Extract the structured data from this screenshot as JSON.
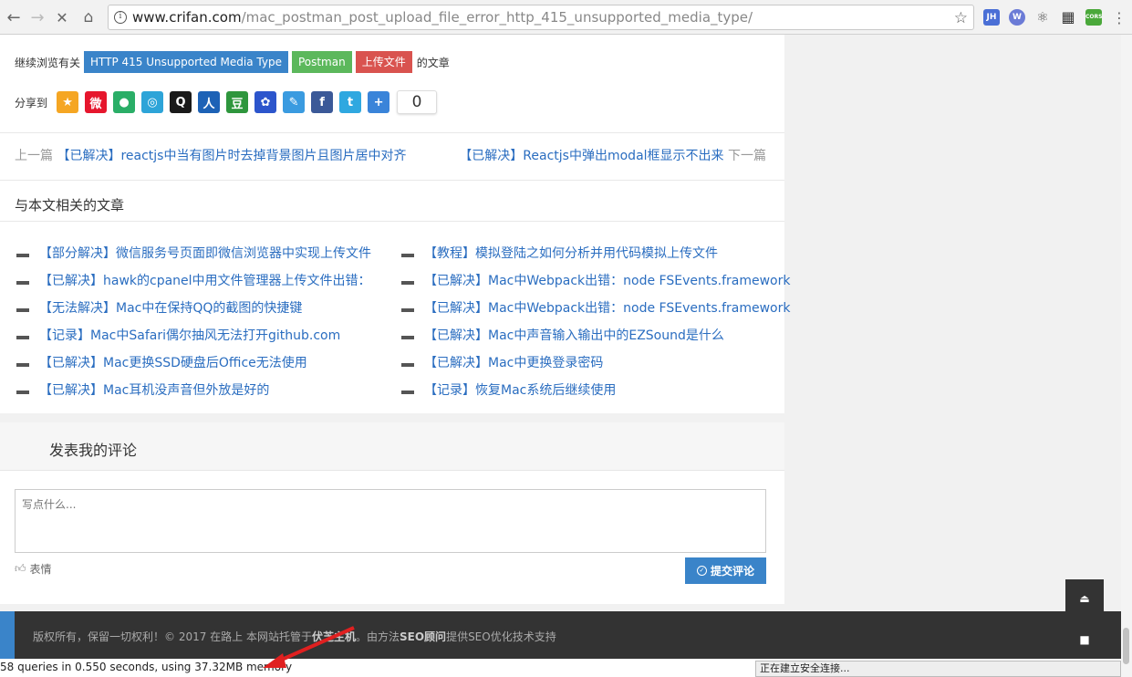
{
  "browser": {
    "url_host": "www.crifan.com",
    "url_path": "/mac_postman_post_upload_file_error_http_415_unsupported_media_type/",
    "extensions": [
      {
        "name": "jh-extension-icon",
        "label": "JH",
        "color": "#4a6fd6"
      },
      {
        "name": "circle-extension-icon",
        "label": "W",
        "color": "#6b7bd6"
      },
      {
        "name": "react-extension-icon",
        "label": "⚛",
        "color": "#f2f2f2"
      },
      {
        "name": "qr-extension-icon",
        "label": "▦",
        "color": "#f2f2f2"
      },
      {
        "name": "cors-extension-icon",
        "label": "CORS",
        "color": "#4aa83a"
      }
    ]
  },
  "tags": {
    "prefix": "继续浏览有关",
    "items": [
      {
        "label": "HTTP 415 Unsupported Media Type",
        "color": "blue"
      },
      {
        "label": "Postman",
        "color": "green"
      },
      {
        "label": "上传文件",
        "color": "red"
      }
    ],
    "suffix": "的文章"
  },
  "share": {
    "label": "分享到",
    "count": "0",
    "icons": [
      {
        "name": "qzone-icon",
        "glyph": "★",
        "color": "#f5a623"
      },
      {
        "name": "weibo-icon",
        "glyph": "微",
        "color": "#e6162d"
      },
      {
        "name": "wechat-icon",
        "glyph": "●",
        "color": "#2aae67"
      },
      {
        "name": "tencent-weibo-icon",
        "glyph": "◎",
        "color": "#2da4d8"
      },
      {
        "name": "qq-icon",
        "glyph": "Q",
        "color": "#1a1a1a"
      },
      {
        "name": "renren-icon",
        "glyph": "人",
        "color": "#1d62b6"
      },
      {
        "name": "douban-icon",
        "glyph": "豆",
        "color": "#2e963d"
      },
      {
        "name": "baidu-icon",
        "glyph": "✿",
        "color": "#2c55cc"
      },
      {
        "name": "edit-icon",
        "glyph": "✎",
        "color": "#3a9be0"
      },
      {
        "name": "facebook-icon",
        "glyph": "f",
        "color": "#3b5998"
      },
      {
        "name": "twitter-icon",
        "glyph": "t",
        "color": "#2fa8e0"
      },
      {
        "name": "more-icon",
        "glyph": "+",
        "color": "#3a84d9"
      }
    ]
  },
  "prevnext": {
    "prev_label": "上一篇",
    "prev_title": "【已解决】reactjs中当有图片时去掉背景图片且图片居中对齐",
    "next_title": "【已解决】Reactjs中弹出modal框显示不出来",
    "next_label": "下一篇"
  },
  "related": {
    "title": "与本文相关的文章",
    "left": [
      "【部分解决】微信服务号页面即微信浏览器中实现上传文件",
      "【已解决】hawk的cpanel中用文件管理器上传文件出错：",
      "【无法解决】Mac中在保持QQ的截图的快捷键",
      "【记录】Mac中Safari偶尔抽风无法打开github.com",
      "【已解决】Mac更换SSD硬盘后Office无法使用",
      "【已解决】Mac耳机没声音但外放是好的"
    ],
    "right": [
      "【教程】模拟登陆之如何分析并用代码模拟上传文件",
      "【已解决】Mac中Webpack出错：node FSEvents.framework",
      "【已解决】Mac中Webpack出错：node FSEvents.framework",
      "【已解决】Mac中声音输入输出中的EZSound是什么",
      "【已解决】Mac中更换登录密码",
      "【记录】恢复Mac系统后继续使用"
    ]
  },
  "comment": {
    "title": "发表我的评论",
    "placeholder": "写点什么...",
    "emoji_label": "表情",
    "submit_label": "提交评论"
  },
  "footer": {
    "text_1": "版权所有，保留一切权利！© 2017 在路上 本网站托管于",
    "host_name": "伏芝主机",
    "text_2": "。由方法",
    "seo_name": "SEO顾问",
    "text_3": "提供SEO优化技术支持"
  },
  "status": {
    "left": "58 queries in 0.550 seconds, using 37.32MB memory",
    "right": "正在建立安全连接..."
  }
}
